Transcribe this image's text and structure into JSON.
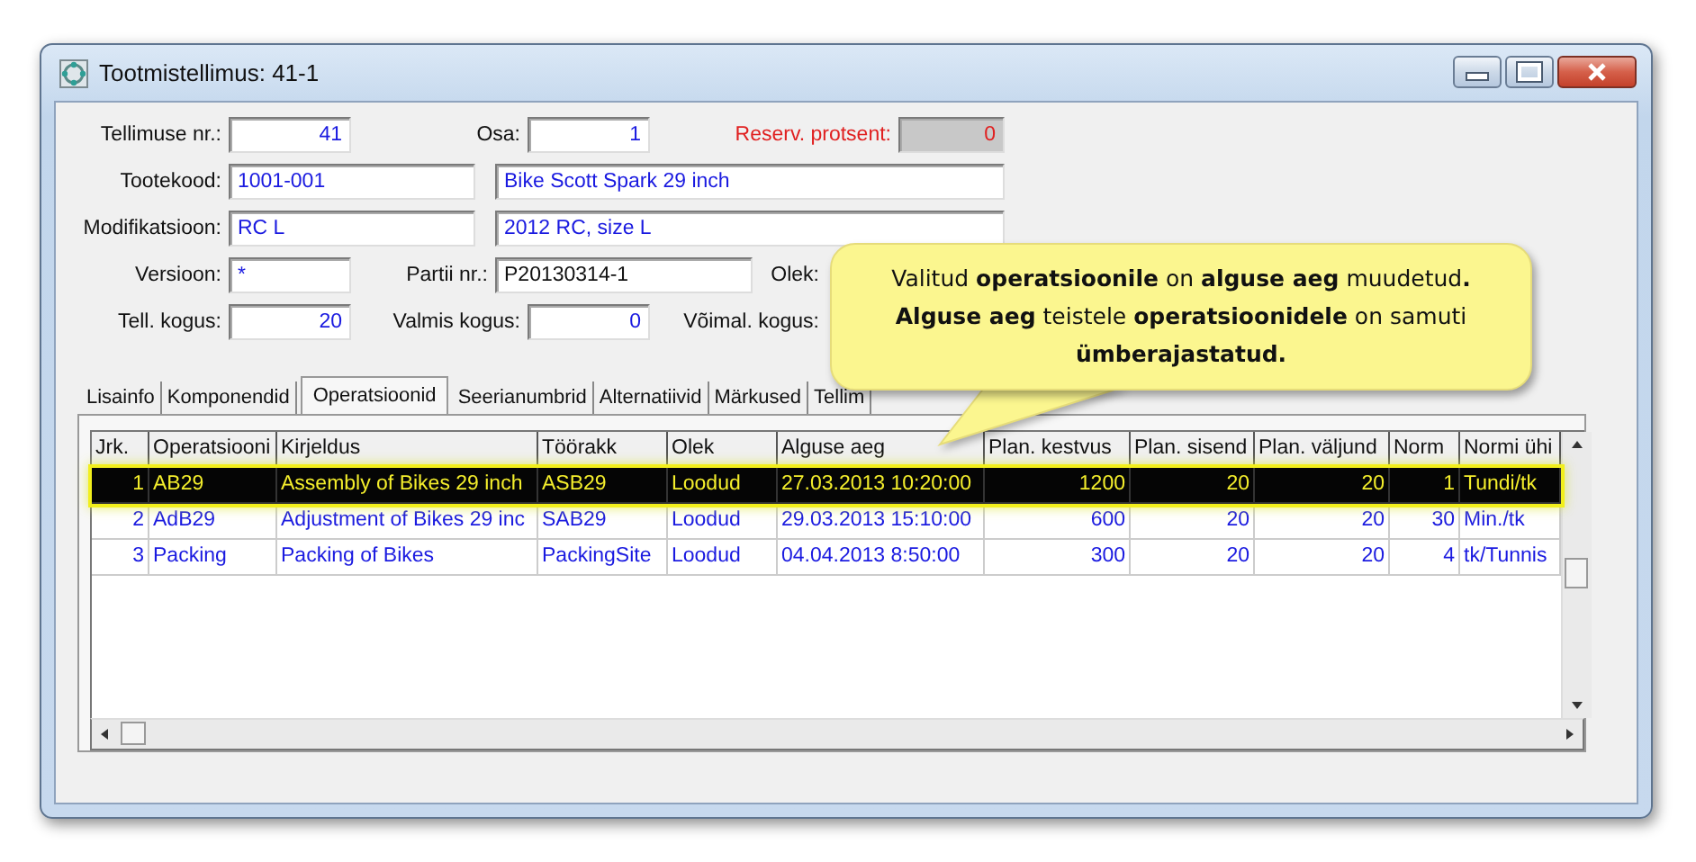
{
  "window": {
    "title": "Tootmistellimus: 41-1"
  },
  "form": {
    "rows": [
      [
        {
          "kind": "label",
          "text": "Tellimuse nr.:"
        },
        {
          "kind": "number",
          "value": "41"
        },
        {
          "kind": "label",
          "text": "Osa:"
        },
        {
          "kind": "number",
          "value": "1"
        },
        {
          "kind": "label",
          "text": "Reserv. protsent:",
          "disabled": true
        },
        {
          "kind": "number",
          "value": "0",
          "disabled": true
        }
      ],
      [
        {
          "kind": "label",
          "text": "Tootekood:"
        },
        {
          "kind": "text",
          "value": "1001-001"
        },
        {
          "kind": "text",
          "value": "Bike Scott Spark 29 inch"
        }
      ],
      [
        {
          "kind": "label",
          "text": "Modifikatsioon:"
        },
        {
          "kind": "text",
          "value": "RC L"
        },
        {
          "kind": "text",
          "value": "2012 RC, size L"
        }
      ],
      [
        {
          "kind": "label",
          "text": "Versioon:"
        },
        {
          "kind": "text",
          "value": "*"
        },
        {
          "kind": "label",
          "text": "Partii nr.:"
        },
        {
          "kind": "plain",
          "value": "P20130314-1"
        },
        {
          "kind": "label",
          "text": "Olek:"
        }
      ],
      [
        {
          "kind": "label",
          "text": "Tell. kogus:"
        },
        {
          "kind": "number",
          "value": "20"
        },
        {
          "kind": "label",
          "text": "Valmis kogus:"
        },
        {
          "kind": "number",
          "value": "0"
        },
        {
          "kind": "label",
          "text": "Võimal. kogus:"
        }
      ]
    ]
  },
  "tabs": [
    {
      "label": "Lisainfo",
      "selected": false
    },
    {
      "label": "Komponendid",
      "selected": false
    },
    {
      "label": "Operatsioonid",
      "selected": true
    },
    {
      "label": "Seerianumbrid",
      "selected": false
    },
    {
      "label": "Alternatiivid",
      "selected": false
    },
    {
      "label": "Märkused",
      "selected": false
    },
    {
      "label": "Tellim",
      "selected": false
    }
  ],
  "table": {
    "columns": [
      {
        "label": "Jrk.",
        "kind": "number"
      },
      {
        "label": "Operatsiooni",
        "kind": "text"
      },
      {
        "label": "Kirjeldus",
        "kind": "text"
      },
      {
        "label": "Töörakk",
        "kind": "text"
      },
      {
        "label": "Olek",
        "kind": "text"
      },
      {
        "label": "Alguse aeg",
        "kind": "text"
      },
      {
        "label": "Plan. kestvus",
        "kind": "number"
      },
      {
        "label": "Plan. sisend",
        "kind": "number"
      },
      {
        "label": "Plan. väljund",
        "kind": "number"
      },
      {
        "label": "Norm",
        "kind": "number"
      },
      {
        "label": "Normi ühi",
        "kind": "text"
      }
    ],
    "rows": [
      {
        "selected": true,
        "cells": [
          "1",
          "AB29",
          "Assembly of Bikes 29 inch",
          "ASB29",
          "Loodud",
          "27.03.2013 10:20:00",
          "1200",
          "20",
          "20",
          "1",
          "Tundi/tk"
        ]
      },
      {
        "selected": false,
        "cells": [
          "2",
          "AdB29",
          "Adjustment of Bikes 29 inc",
          "SAB29",
          "Loodud",
          "29.03.2013 15:10:00",
          "600",
          "20",
          "20",
          "30",
          "Min./tk"
        ]
      },
      {
        "selected": false,
        "cells": [
          "3",
          "Packing",
          "Packing of Bikes",
          "PackingSite",
          "Loodud",
          "04.04.2013 8:50:00",
          "300",
          "20",
          "20",
          "4",
          "tk/Tunnis"
        ]
      }
    ]
  },
  "callout": {
    "text": "Valitud **operatsioonile** on **alguse aeg** muudetud**.** **Alguse aeg** teistele **operatsioonidele** on samuti **ümberajastatud.**"
  }
}
